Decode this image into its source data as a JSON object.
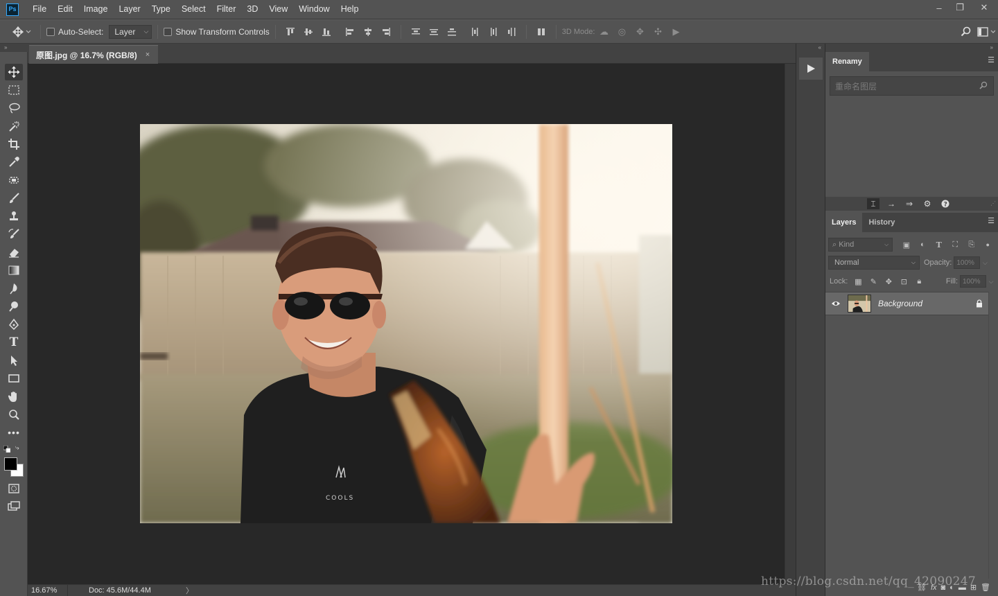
{
  "app": {
    "logo": "Ps"
  },
  "menubar": {
    "items": [
      "File",
      "Edit",
      "Image",
      "Layer",
      "Type",
      "Select",
      "Filter",
      "3D",
      "View",
      "Window",
      "Help"
    ],
    "window_controls": {
      "minimize": "–",
      "restore": "❐",
      "close": "✕"
    }
  },
  "options_bar": {
    "auto_select_label": "Auto-Select:",
    "auto_select_checked": false,
    "auto_select_target": "Layer",
    "show_transform_label": "Show Transform Controls",
    "show_transform_checked": false,
    "mode_3d_label": "3D Mode:"
  },
  "document": {
    "tab_title": "原图.jpg @ 16.7% (RGB/8)",
    "close_glyph": "×"
  },
  "status_bar": {
    "zoom": "16.67%",
    "doc_info": "Doc: 45.6M/44.4M",
    "arrow": "〉"
  },
  "renamy_panel": {
    "tab_label": "Renamy",
    "search_placeholder": "重命名图层"
  },
  "layers_panel": {
    "tabs": [
      "Layers",
      "History"
    ],
    "active_tab": "Layers",
    "filter_kind": "Kind",
    "blend_mode": "Normal",
    "opacity_label": "Opacity:",
    "opacity_value": "100%",
    "lock_label": "Lock:",
    "fill_label": "Fill:",
    "fill_value": "100%",
    "layers": [
      {
        "name": "Background",
        "visible": true,
        "locked": true
      }
    ]
  },
  "collapsed_toggle_left": "»",
  "collapsed_toggle_right": "«",
  "watermark": "https://blog.csdn.net/qq_42090247",
  "colors": {
    "ui_base": "#535353",
    "ui_dark": "#424242",
    "canvas_bg": "#282828",
    "foreground_swatch": "#000000",
    "background_swatch": "#ffffff",
    "ps_accent": "#31a8ff"
  }
}
